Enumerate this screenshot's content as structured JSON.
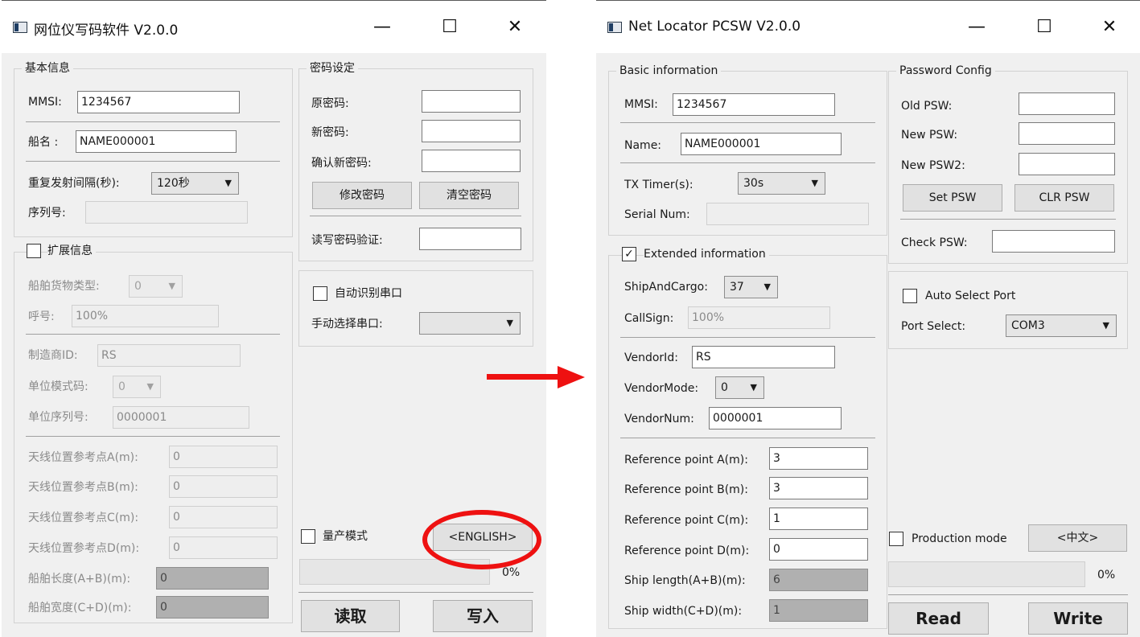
{
  "colors": {
    "highlight": "#ee1111",
    "window_bg": "#f0f0f0"
  },
  "left": {
    "title": "网位仪写码软件 V2.0.0",
    "basic_title": "基本信息",
    "mmsi_label": "MMSI:",
    "mmsi_value": "1234567",
    "name_label": "船名 :",
    "name_value": "NAME000001",
    "tx_label": "重复发射间隔(秒):",
    "tx_value": "120秒",
    "serial_label": "序列号:",
    "serial_value": "",
    "ext_title": "扩展信息",
    "ext_checked": "",
    "cargo_label": "船舶货物类型:",
    "cargo_value": "0",
    "callsign_label": "呼号:",
    "callsign_value": "100%",
    "vendorid_label": "制造商ID:",
    "vendorid_value": "RS",
    "vendormode_label": "单位模式码:",
    "vendormode_value": "0",
    "vendornum_label": "单位序列号:",
    "vendornum_value": "0000001",
    "refA_label": "天线位置参考点A(m):",
    "refA_value": "0",
    "refB_label": "天线位置参考点B(m):",
    "refB_value": "0",
    "refC_label": "天线位置参考点C(m):",
    "refC_value": "0",
    "refD_label": "天线位置参考点D(m):",
    "refD_value": "0",
    "length_label": "船舶长度(A+B)(m):",
    "length_value": "0",
    "width_label": "船舶宽度(C+D)(m):",
    "width_value": "0",
    "pw_title": "密码设定",
    "oldpw_label": "原密码:",
    "newpw_label": "新密码:",
    "newpw2_label": "确认新密码:",
    "set_btn": "修改密码",
    "clr_btn": "清空密码",
    "check_label": "读写密码验证:",
    "auto_port_label": "自动识别串口",
    "port_label": "手动选择串口:",
    "port_value": "",
    "prod_label": "量产模式",
    "lang_btn": "<ENGLISH>",
    "progress_text": "0%",
    "progress_value": 0,
    "read_btn": "读取",
    "write_btn": "写入"
  },
  "right": {
    "title": "Net Locator PCSW V2.0.0",
    "basic_title": "Basic information",
    "mmsi_label": "MMSI:",
    "mmsi_value": "1234567",
    "name_label": "Name:",
    "name_value": "NAME000001",
    "tx_label": "TX Timer(s):",
    "tx_value": "30s",
    "serial_label": "Serial Num:",
    "serial_value": "",
    "ext_title": "Extended information",
    "ext_checked": "✓",
    "cargo_label": "ShipAndCargo:",
    "cargo_value": "37",
    "callsign_label": "CallSign:",
    "callsign_value": "100%",
    "vendorid_label": "VendorId:",
    "vendorid_value": "RS",
    "vendormode_label": "VendorMode:",
    "vendormode_value": "0",
    "vendornum_label": "VendorNum:",
    "vendornum_value": "0000001",
    "refA_label": "Reference point A(m):",
    "refA_value": "3",
    "refB_label": "Reference point B(m):",
    "refB_value": "3",
    "refC_label": "Reference point C(m):",
    "refC_value": "1",
    "refD_label": "Reference point D(m):",
    "refD_value": "0",
    "length_label": "Ship length(A+B)(m):",
    "length_value": "6",
    "width_label": "Ship width(C+D)(m):",
    "width_value": "1",
    "pw_title": "Password Config",
    "oldpw_label": "Old PSW:",
    "newpw_label": "New PSW:",
    "newpw2_label": "New PSW2:",
    "set_btn": "Set PSW",
    "clr_btn": "CLR PSW",
    "check_label": "Check PSW:",
    "auto_port_label": "Auto Select Port",
    "port_label": "Port Select:",
    "port_value": "COM3",
    "prod_label": "Production mode",
    "lang_btn": "<中文>",
    "progress_text": "0%",
    "progress_value": 0,
    "read_btn": "Read",
    "write_btn": "Write"
  }
}
